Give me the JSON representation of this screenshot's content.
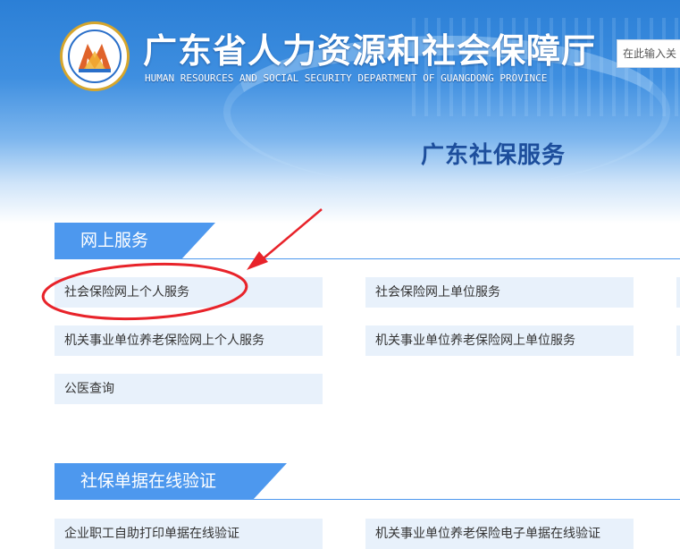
{
  "header": {
    "site_title": "广东省人力资源和社会保障厅",
    "site_subtitle": "HUMAN RESOURCES AND SOCIAL SECURITY DEPARTMENT OF GUANGDONG PROVINCE",
    "search_placeholder": "在此输入关",
    "logo_icon": "department-emblem-icon"
  },
  "page_title": "广东社保服务",
  "sections": [
    {
      "title": "网上服务",
      "items": [
        "社会保险网上个人服务",
        "社会保险网上单位服务",
        "机关事业单位养老保险网上个人服务",
        "机关事业单位养老保险网上单位服务",
        "公医查询"
      ]
    },
    {
      "title": "社保单据在线验证",
      "items": [
        "企业职工自助打印单据在线验证",
        "机关事业单位养老保险电子单据在线验证"
      ]
    }
  ],
  "annotation": {
    "highlighted_item": "社会保险网上个人服务",
    "color": "#e8232a"
  },
  "colors": {
    "accent": "#4d98ee",
    "title_blue": "#1d4e9c",
    "item_bg": "#e8f1fb"
  }
}
